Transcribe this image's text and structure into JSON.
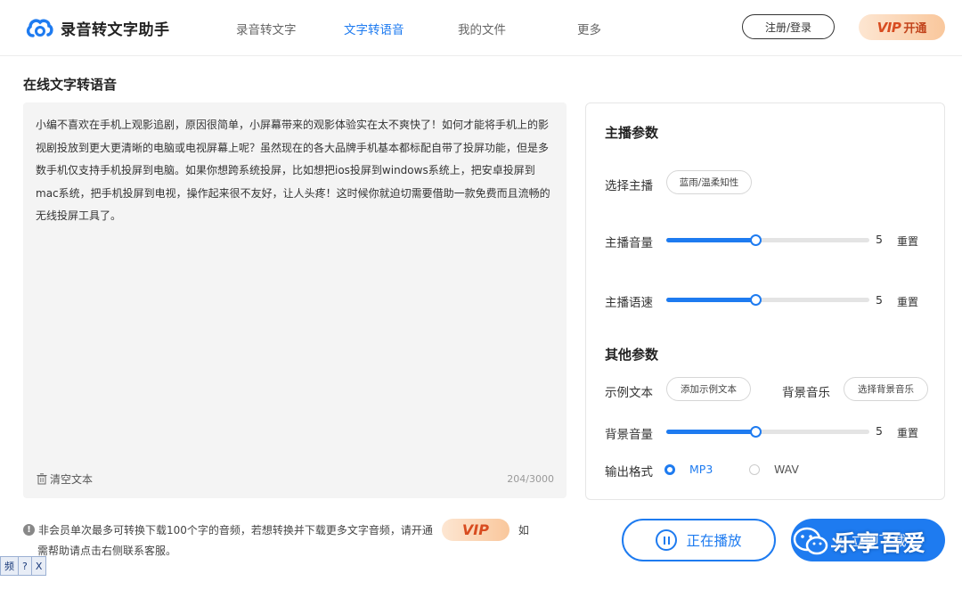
{
  "header": {
    "logo_text": "录音转文字助手",
    "nav": [
      {
        "label": "录音转文字",
        "active": false
      },
      {
        "label": "文字转语音",
        "active": true
      },
      {
        "label": "我的文件",
        "active": false
      },
      {
        "label": "更多",
        "active": false
      }
    ],
    "login_label": "注册/登录",
    "vip_mark": "VIP",
    "vip_open": "开通"
  },
  "page_title": "在线文字转语音",
  "editor": {
    "text": "小编不喜欢在手机上观影追剧，原因很简单，小屏幕带来的观影体验实在太不爽快了！如何才能将手机上的影视剧投放到更大更清晰的电脑或电视屏幕上呢？虽然现在的各大品牌手机基本都标配自带了投屏功能，但是多数手机仅支持手机投屏到电脑。如果你想跨系统投屏，比如想把ios投屏到windows系统上，把安卓投屏到mac系统，把手机投屏到电视，操作起来很不友好，让人头疼！这时候你就迫切需要借助一款免费而且流畅的无线投屏工具了。",
    "clear_label": "清空文本",
    "char_count": "204/3000"
  },
  "params": {
    "anchor_title": "主播参数",
    "select_anchor_label": "选择主播",
    "anchor_value": "蓝雨/温柔知性",
    "volume_label": "主播音量",
    "volume_value": "5",
    "speed_label": "主播语速",
    "speed_value": "5",
    "reset_label": "重置",
    "other_title": "其他参数",
    "sample_label": "示例文本",
    "sample_btn": "添加示例文本",
    "bgm_label": "背景音乐",
    "bgm_btn": "选择背景音乐",
    "bgm_volume_label": "背景音量",
    "bgm_volume_value": "5",
    "format_label": "输出格式",
    "formats": [
      {
        "label": "MP3",
        "checked": true
      },
      {
        "label": "WAV",
        "checked": false
      }
    ],
    "slider_fraction": 0.44
  },
  "notice": {
    "icon": "!",
    "line1_before": "非会员单次最多可转换下载100个字的音频，若想转换并下载更多文字音频，请开通",
    "vip_mark": "VIP",
    "line1_after": "如",
    "line2": "需帮助请点击右侧联系客服。"
  },
  "actions": {
    "play_label": "正在播放",
    "download_label": "立即下载"
  },
  "watermark": {
    "text": "乐享吾爱"
  },
  "mini_toolbar": {
    "item1": "频",
    "item2": "?",
    "item3": "X"
  },
  "colors": {
    "accent": "#1e7bf0",
    "vip_gradient_start": "#fde6d2",
    "vip_gradient_end": "#f9c79c",
    "vip_text": "#d84c20"
  }
}
